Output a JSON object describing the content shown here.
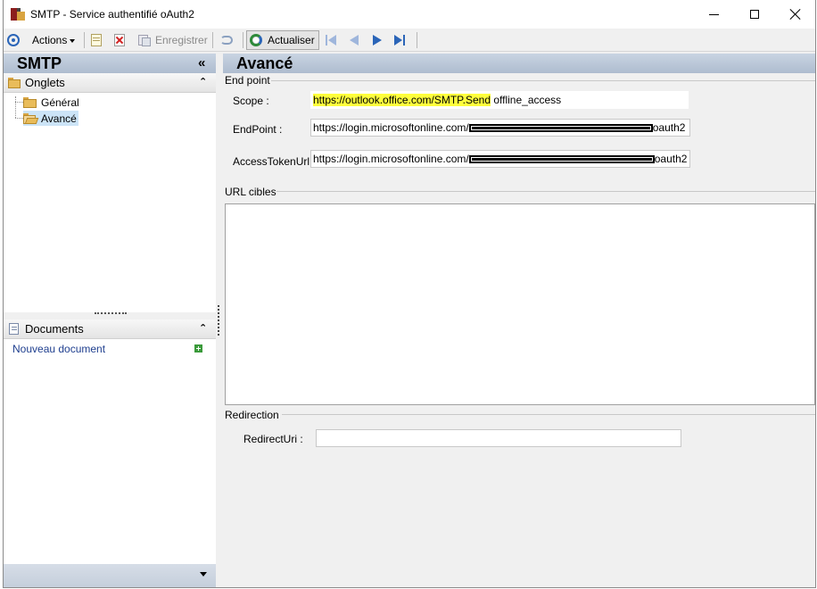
{
  "window": {
    "title": "SMTP -  Service authentifié oAuth2",
    "controls": {
      "minimize": "minimize",
      "maximize": "maximize",
      "close": "close"
    }
  },
  "toolbar": {
    "actions_label": "Actions",
    "save_label": "Enregistrer",
    "refresh_label": "Actualiser"
  },
  "left": {
    "title": "SMTP",
    "tabs_group": {
      "label": "Onglets",
      "items": [
        {
          "label": "Général",
          "selected": false
        },
        {
          "label": "Avancé",
          "selected": true
        }
      ]
    },
    "documents_group": {
      "label": "Documents",
      "new_document": "Nouveau document"
    }
  },
  "right": {
    "title": "Avancé",
    "endpoint_section": {
      "label": "End point",
      "scope_label": "Scope :",
      "scope_highlight": "https://outlook.office.com/SMTP.Send",
      "scope_rest": " offline_access",
      "endpoint_label": "EndPoint :",
      "endpoint_prefix": "https://login.microsoftonline.com/",
      "endpoint_suffix": "oauth2",
      "token_label": "AccessTokenUrl :",
      "token_prefix": "https://login.microsoftonline.com/",
      "token_suffix": "oauth2"
    },
    "urls_section": {
      "label": "URL cibles"
    },
    "redirection_section": {
      "label": "Redirection",
      "redirect_label": "RedirectUri :",
      "redirect_value": ""
    }
  },
  "colors": {
    "highlight": "#ffff3c",
    "header_gradient_top": "#c9d4e2",
    "header_gradient_bottom": "#aebccf",
    "link": "#1f3f8f",
    "selection": "#cce4f7"
  }
}
